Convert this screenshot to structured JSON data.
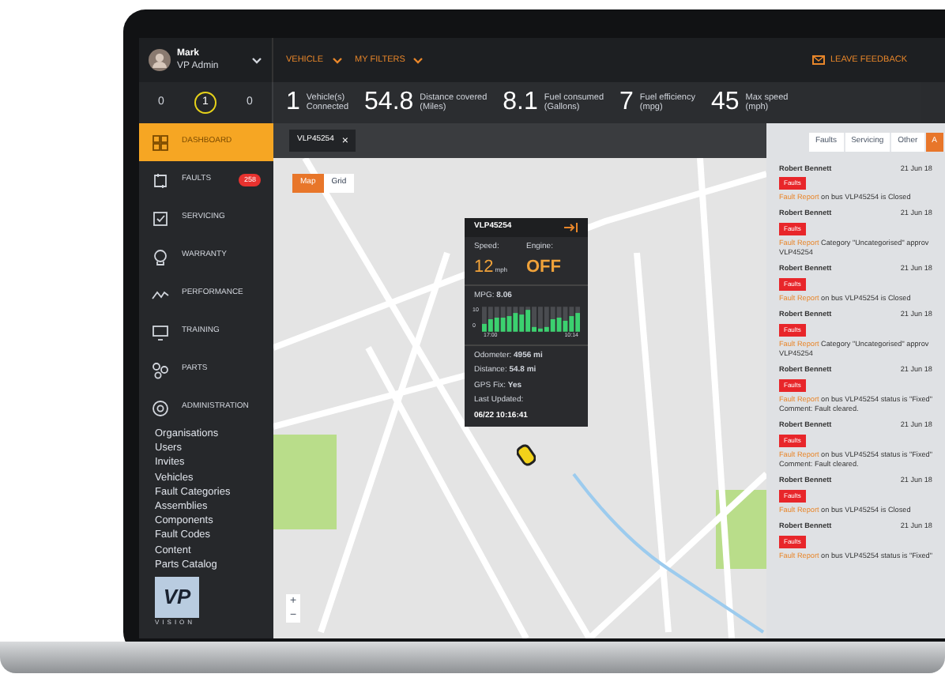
{
  "header": {
    "user": {
      "name": "Mark",
      "role": "VP Admin"
    },
    "menus": [
      {
        "label": "VEHICLE"
      },
      {
        "label": "MY FILTERS"
      }
    ],
    "feedback": "LEAVE FEEDBACK"
  },
  "counters": [
    {
      "value": "0",
      "selected": false
    },
    {
      "value": "1",
      "selected": true
    },
    {
      "value": "0",
      "selected": false
    }
  ],
  "stats": [
    {
      "value": "1",
      "lines": [
        "Vehicle(s)",
        "Connected"
      ]
    },
    {
      "value": "54.8",
      "lines": [
        "Distance covered",
        "(Miles)"
      ]
    },
    {
      "value": "8.1",
      "lines": [
        "Fuel consumed",
        "(Gallons)"
      ]
    },
    {
      "value": "7",
      "lines": [
        "Fuel efficiency",
        "(mpg)"
      ]
    },
    {
      "value": "45",
      "lines": [
        "Max speed",
        "(mph)"
      ]
    }
  ],
  "sidebar": {
    "items": [
      {
        "kind": "dashboard",
        "label": "DASHBOARD",
        "selected": true
      },
      {
        "kind": "faults",
        "label": "FAULTS",
        "selected": false,
        "badge": "258"
      },
      {
        "kind": "servicing",
        "label": "SERVICING",
        "selected": false
      },
      {
        "kind": "warranty",
        "label": "WARRANTY",
        "selected": false
      },
      {
        "kind": "performance",
        "label": "PERFORMANCE",
        "selected": false
      },
      {
        "kind": "training",
        "label": "TRAINING",
        "selected": false
      },
      {
        "kind": "parts",
        "label": "PARTS",
        "selected": false
      },
      {
        "kind": "admin",
        "label": "ADMINISTRATION",
        "selected": false,
        "children": [
          "Organisations",
          "Users",
          "Invites",
          "Vehicles",
          "Fault Categories",
          "Assemblies",
          "Components",
          "Fault Codes",
          "Content",
          "Parts Catalog"
        ]
      }
    ],
    "logo": {
      "mark": "VP",
      "word": "VISION"
    }
  },
  "filter_chip": {
    "label": "VLP45254",
    "close": "×"
  },
  "map": {
    "views": [
      {
        "label": "Map",
        "selected": true
      },
      {
        "label": "Grid",
        "selected": false
      }
    ],
    "zoom": [
      "+",
      "−"
    ],
    "popup": {
      "title": "VLP45254",
      "speed_label": "Speed:",
      "speed": "12",
      "speed_unit": "mph",
      "engine_label": "Engine:",
      "engine": "OFF",
      "mpg": "MPG: **8.06**",
      "chart_ticks": [
        "10",
        "0"
      ],
      "chart_times": [
        "17:00",
        "10:14"
      ],
      "details": [
        "Odometer: **4956 mi**",
        "Distance: **54.8 mi**",
        "GPS Fix: **Yes**",
        "Last Updated:"
      ],
      "updated": "06/22 10:16:41"
    }
  },
  "feed": {
    "tabs": [
      {
        "label": "Faults",
        "selected": false
      },
      {
        "label": "Servicing",
        "selected": false
      },
      {
        "label": "Other",
        "selected": false
      },
      {
        "label": "A",
        "selected": true
      }
    ],
    "items": [
      {
        "name": "Robert Bennett",
        "date": "21 Jun 18",
        "tag": "Faults",
        "link": "Fault Report",
        "text": "on bus VLP45254 is Closed"
      },
      {
        "name": "Robert Bennett",
        "date": "21 Jun 18",
        "tag": "Faults",
        "link": "Fault Report",
        "text": "Category \"Uncategorised\" approv VLP45254"
      },
      {
        "name": "Robert Bennett",
        "date": "21 Jun 18",
        "tag": "Faults",
        "link": "Fault Report",
        "text": "on bus VLP45254 is Closed"
      },
      {
        "name": "Robert Bennett",
        "date": "21 Jun 18",
        "tag": "Faults",
        "link": "Fault Report",
        "text": "Category \"Uncategorised\" approv VLP45254"
      },
      {
        "name": "Robert Bennett",
        "date": "21 Jun 18",
        "tag": "Faults",
        "link": "Fault Report",
        "text": "on bus VLP45254 status is \"Fixed\" Comment: Fault cleared."
      },
      {
        "name": "Robert Bennett",
        "date": "21 Jun 18",
        "tag": "Faults",
        "link": "Fault Report",
        "text": "on bus VLP45254 status is \"Fixed\" Comment: Fault cleared."
      },
      {
        "name": "Robert Bennett",
        "date": "21 Jun 18",
        "tag": "Faults",
        "link": "Fault Report",
        "text": "on bus VLP45254 is Closed"
      },
      {
        "name": "Robert Bennett",
        "date": "21 Jun 18",
        "tag": "Faults",
        "link": "Fault Report",
        "text": "on bus VLP45254 status is \"Fixed\""
      }
    ]
  }
}
